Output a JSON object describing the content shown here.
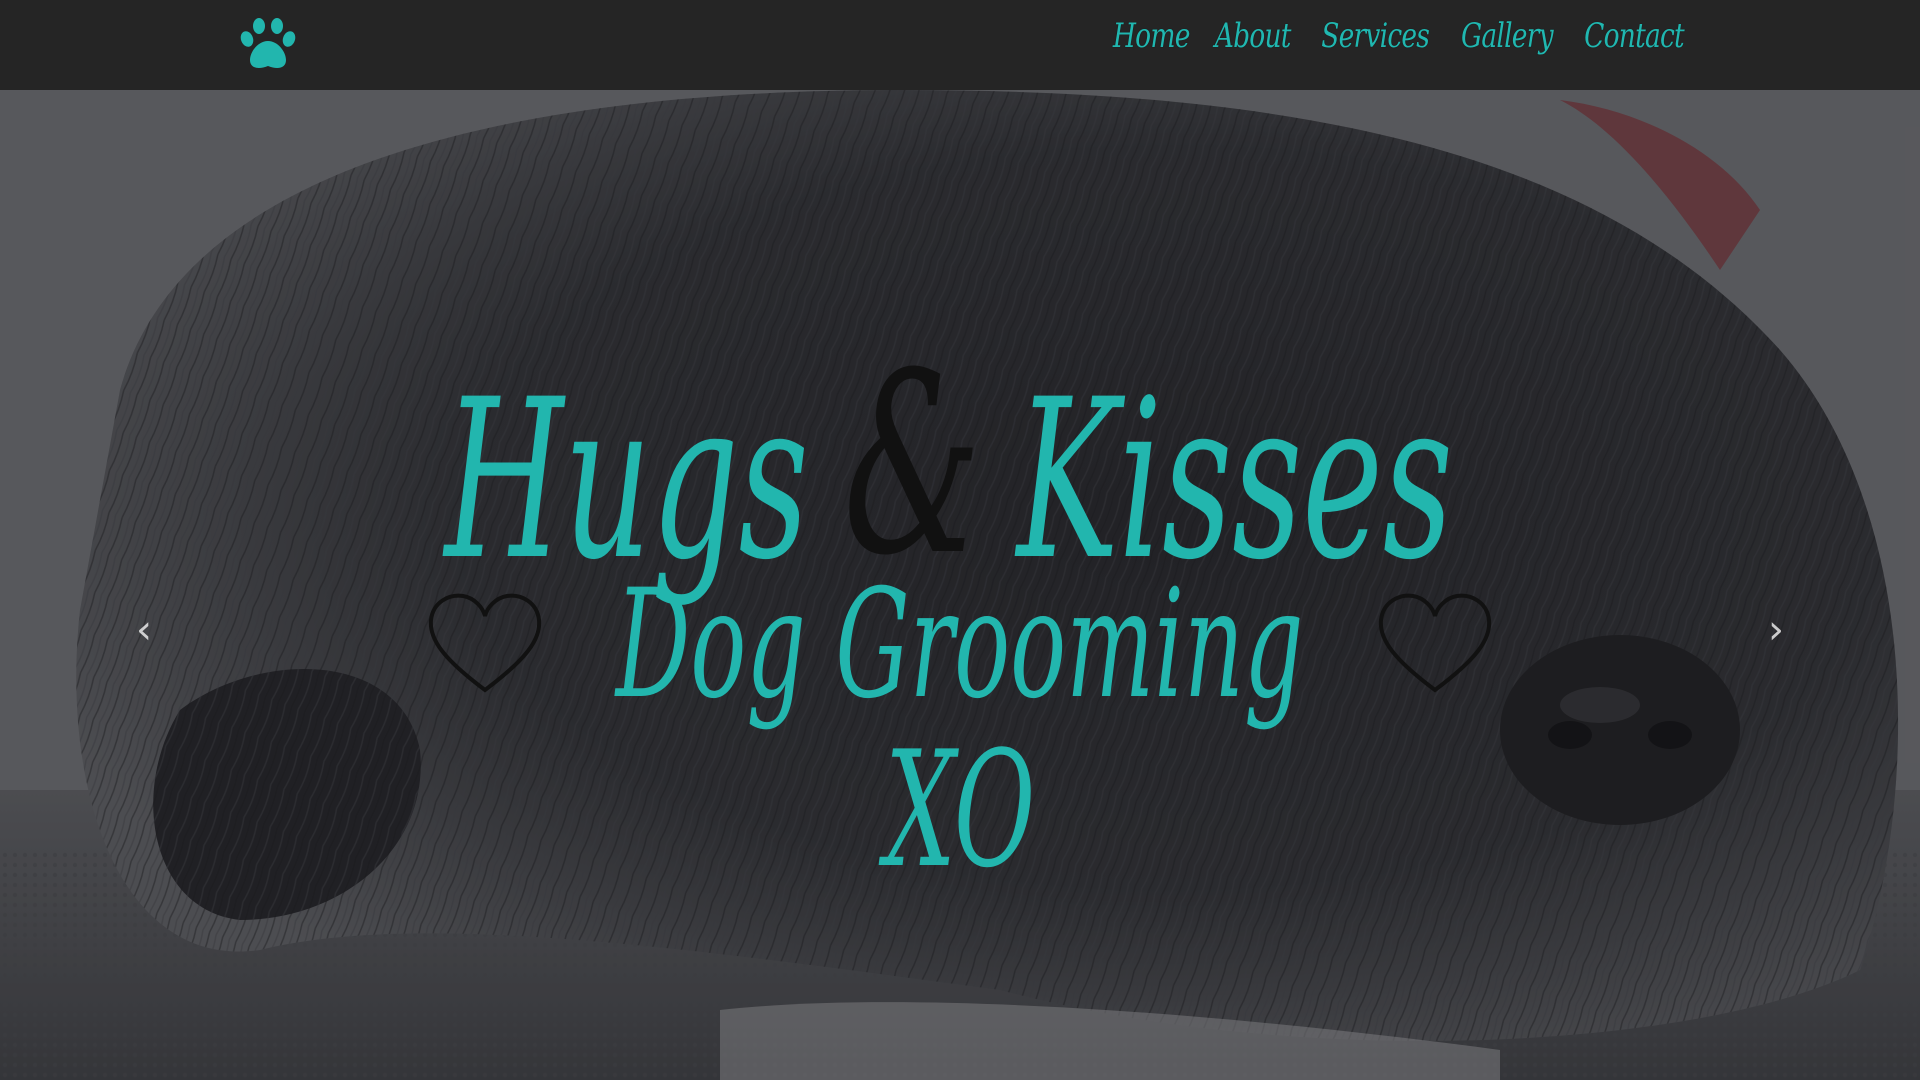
{
  "nav": {
    "logo_icon": "paw-icon",
    "links": [
      {
        "label": "Home"
      },
      {
        "label": "About"
      },
      {
        "label": "Services"
      },
      {
        "label": "Gallery"
      },
      {
        "label": "Contact"
      }
    ]
  },
  "hero": {
    "title_part1": "Hugs",
    "title_amp": "&",
    "title_part2": "Kisses",
    "subtitle": "Dog Grooming",
    "tagline": "XO",
    "prev_icon": "chevron-left-icon",
    "next_icon": "chevron-right-icon"
  },
  "colors": {
    "accent": "#22b6ae",
    "navbar": "#252525",
    "ampersand": "#111111"
  }
}
